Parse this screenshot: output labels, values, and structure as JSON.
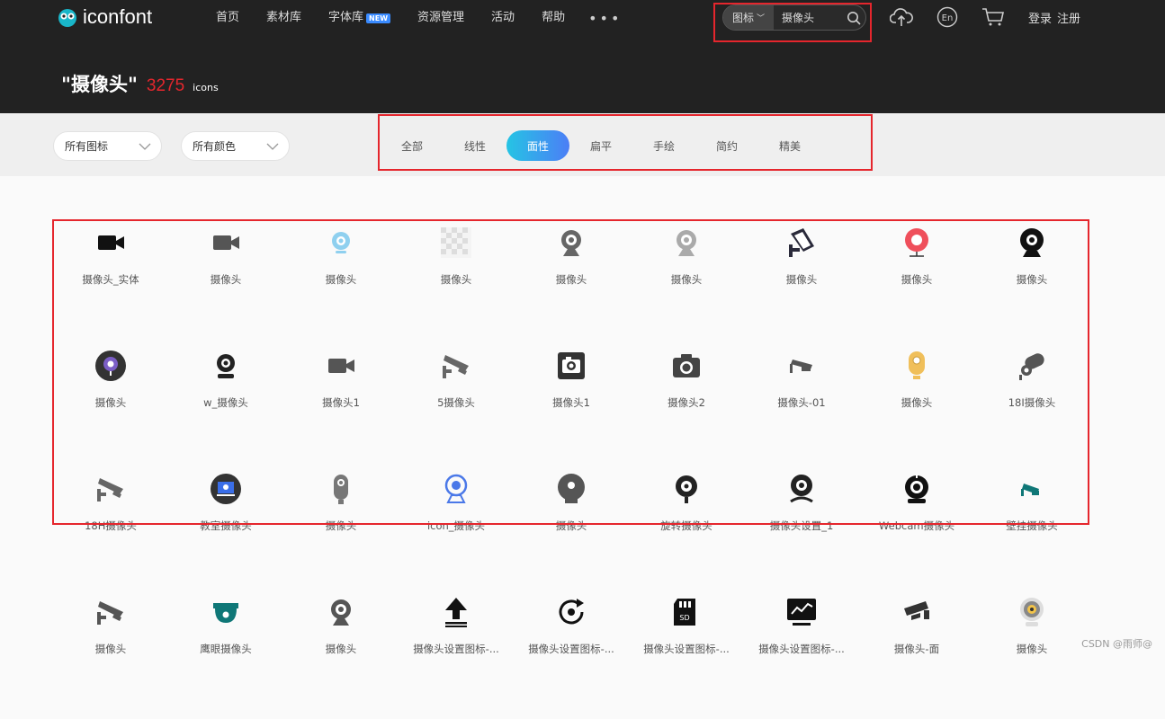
{
  "header": {
    "logo_text": "iconfont",
    "nav": [
      {
        "label": "首页"
      },
      {
        "label": "素材库"
      },
      {
        "label": "字体库",
        "badge": "NEW"
      },
      {
        "label": "资源管理"
      },
      {
        "label": "活动"
      },
      {
        "label": "帮助"
      }
    ],
    "more_label": "•••",
    "search": {
      "type_label": "图标",
      "value": "摄像头"
    },
    "lang_label": "En",
    "login_label": "登录",
    "register_label": "注册"
  },
  "result": {
    "query": "\"摄像头\"",
    "count": "3275",
    "unit": "icons"
  },
  "filters": {
    "category_dropdown": "所有图标",
    "color_dropdown": "所有颜色",
    "styles": [
      "全部",
      "线性",
      "面性",
      "扁平",
      "手绘",
      "简约",
      "精美"
    ],
    "active_style": "面性"
  },
  "icons": [
    {
      "label": "摄像头_实体",
      "icon": "video-camera-icon",
      "color": "#111111"
    },
    {
      "label": "摄像头",
      "icon": "video-camera-icon",
      "color": "#555555"
    },
    {
      "label": "摄像头",
      "icon": "webcam-soft-icon",
      "color": "#8fd0ef"
    },
    {
      "label": "摄像头",
      "icon": "transparent-placeholder-icon",
      "color": "#dddddd"
    },
    {
      "label": "摄像头",
      "icon": "webcam-ring-icon",
      "color": "#666666"
    },
    {
      "label": "摄像头",
      "icon": "webcam-ring-icon",
      "color": "#aaaaaa"
    },
    {
      "label": "摄像头",
      "icon": "security-camera-icon",
      "color": "#2a2a3a"
    },
    {
      "label": "摄像头",
      "icon": "webcam-red-icon",
      "color": "#ef4f5b"
    },
    {
      "label": "摄像头",
      "icon": "webcam-ball-icon",
      "color": "#111111"
    },
    {
      "label": "摄像头",
      "icon": "webcam-circle-purple-icon",
      "color": "#7b5ec6"
    },
    {
      "label": "w_摄像头",
      "icon": "webcam-dome-icon",
      "color": "#222222"
    },
    {
      "label": "摄像头1",
      "icon": "video-camera-icon",
      "color": "#555555"
    },
    {
      "label": "5摄像头",
      "icon": "cctv-icon",
      "color": "#666666"
    },
    {
      "label": "摄像头1",
      "icon": "camera-square-icon",
      "color": "#333333"
    },
    {
      "label": "摄像头2",
      "icon": "photo-camera-icon",
      "color": "#444444"
    },
    {
      "label": "摄像头-01",
      "icon": "cctv-small-icon",
      "color": "#555555"
    },
    {
      "label": "摄像头",
      "icon": "webcam-yellow-icon",
      "color": "#f0bf5a"
    },
    {
      "label": "18I摄像头",
      "icon": "bullet-camera-icon",
      "color": "#555555"
    },
    {
      "label": "18H摄像头",
      "icon": "cctv-icon",
      "color": "#666666"
    },
    {
      "label": "教室摄像头",
      "icon": "classroom-camera-icon",
      "color": "#333333"
    },
    {
      "label": "摄像头",
      "icon": "webcam-capsule-icon",
      "color": "#777777"
    },
    {
      "label": "icon_摄像头",
      "icon": "webcam-blue-icon",
      "color": "#4a78e8"
    },
    {
      "label": "摄像头",
      "icon": "webcam-grey-icon",
      "color": "#555555"
    },
    {
      "label": "旋转摄像头",
      "icon": "rotating-camera-icon",
      "color": "#222222"
    },
    {
      "label": "摄像头设置_1",
      "icon": "webcam-settings-icon",
      "color": "#222222"
    },
    {
      "label": "Webcam摄像头",
      "icon": "webcam-black-icon",
      "color": "#111111"
    },
    {
      "label": "壁挂摄像头",
      "icon": "wall-camera-icon",
      "color": "#0f7777"
    },
    {
      "label": "摄像头",
      "icon": "cctv-icon",
      "color": "#555555"
    },
    {
      "label": "鹰眼摄像头",
      "icon": "dome-camera-icon",
      "color": "#0f7777"
    },
    {
      "label": "摄像头",
      "icon": "webcam-ring-icon",
      "color": "#555555"
    },
    {
      "label": "摄像头设置图标-...",
      "icon": "upload-icon",
      "color": "#111111"
    },
    {
      "label": "摄像头设置图标-...",
      "icon": "rotate-icon",
      "color": "#111111"
    },
    {
      "label": "摄像头设置图标-...",
      "icon": "sd-card-icon",
      "color": "#111111"
    },
    {
      "label": "摄像头设置图标-...",
      "icon": "monitor-chart-icon",
      "color": "#111111"
    },
    {
      "label": "摄像头-面",
      "icon": "cctv-dark-icon",
      "color": "#333333"
    },
    {
      "label": "摄像头",
      "icon": "webcam-gold-icon",
      "color": "#888888"
    }
  ],
  "watermark": "CSDN @雨师@",
  "colors": {
    "accent_red": "#e5262d",
    "active_start": "#25c4e4",
    "active_end": "#4c7ef6",
    "topbar": "#222222"
  }
}
